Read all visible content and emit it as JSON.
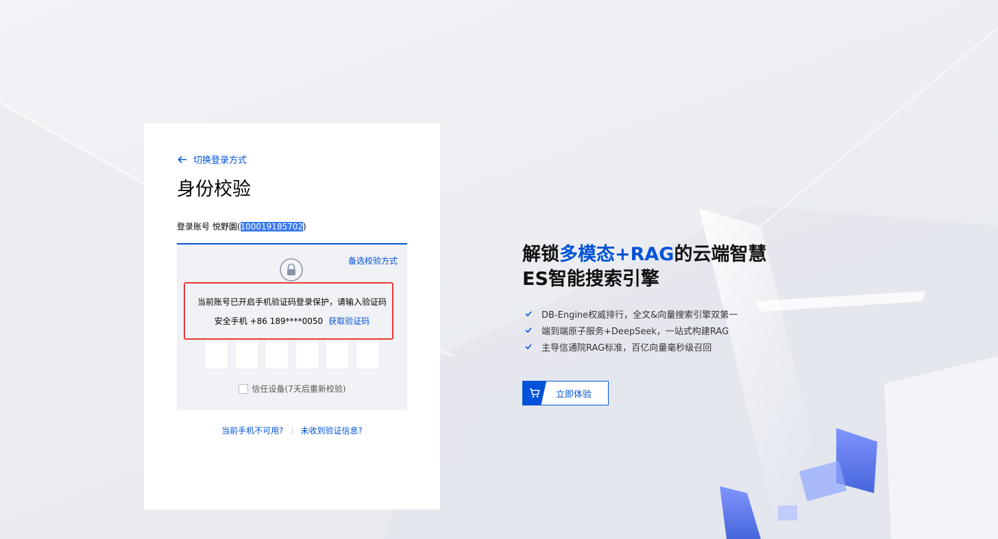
{
  "login": {
    "back_label": "切换登录方式",
    "title": "身份校验",
    "account_prefix": "登录账号 悦野園(",
    "account_id": "100019185702",
    "account_suffix": ")",
    "alt_method": "备选校验方式",
    "notice": "当前账号已开启手机验证码登录保护，请输入验证码",
    "phone_label": "安全手机 +86 189****0050",
    "get_code": "获取验证码",
    "code_length": 6,
    "trust_device": "信任设备(7天后重新校验)",
    "phone_unavailable": "当前手机不可用?",
    "no_code_received": "未收到验证信息?"
  },
  "promo": {
    "title_line1_pre": "解锁",
    "title_line1_hl": "多模态+RAG",
    "title_line1_post": "的云端智慧",
    "title_line2": "ES智能搜索引擎",
    "features": [
      "DB-Engine权威排行，全文&向量搜索引擎双第一",
      "端到端原子服务+DeepSeek，一站式构建RAG",
      "主导信通院RAG标准，百亿向量毫秒级召回"
    ],
    "cta_label": "立即体验"
  },
  "colors": {
    "accent": "#0052d9",
    "highlight_box": "#e53935",
    "selection": "#3a7af0"
  }
}
